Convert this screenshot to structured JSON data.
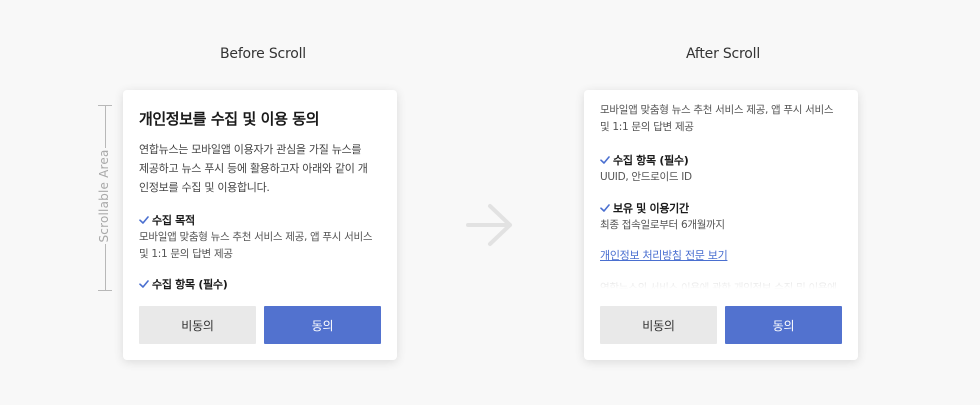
{
  "labels": {
    "before": "Before Scroll",
    "after": "After Scroll"
  },
  "scroll_indicator": {
    "text": "Scrollable Area"
  },
  "dialog": {
    "title": "개인정보를 수집 및 이용 동의",
    "intro_lines": [
      "연합뉴스는 모바일앱 이용자가 관심을 가질 뉴스를",
      "제공하고 뉴스 푸시 등에 활용하고자 아래와 같이 개",
      "인정보를 수집 및 이용합니다."
    ],
    "sections": [
      {
        "heading": "수집 목적",
        "lines": [
          "모바일앱 맞춤형 뉴스 추천 서비스 제공, 앱 푸시 서비스",
          "및 1:1 문의 답변 제공"
        ]
      },
      {
        "heading": "수집 항목 (필수)",
        "lines": [
          "UUID, 안드로이드 ID"
        ]
      },
      {
        "heading": "보유 및 이용기간",
        "lines": [
          "최종 접속일로부터 6개월까지"
        ]
      }
    ],
    "policy_link": "개인정보 처리방침 전문 보기",
    "trailing_text": "연합뉴스의 서비스 이용에 관한 개인정보 수집 및 이용에",
    "buttons": {
      "disagree": "비동의",
      "agree": "동의"
    }
  },
  "colors": {
    "accent": "#5272cf",
    "link": "#4a6fd0",
    "check": "#4a6fd0"
  }
}
